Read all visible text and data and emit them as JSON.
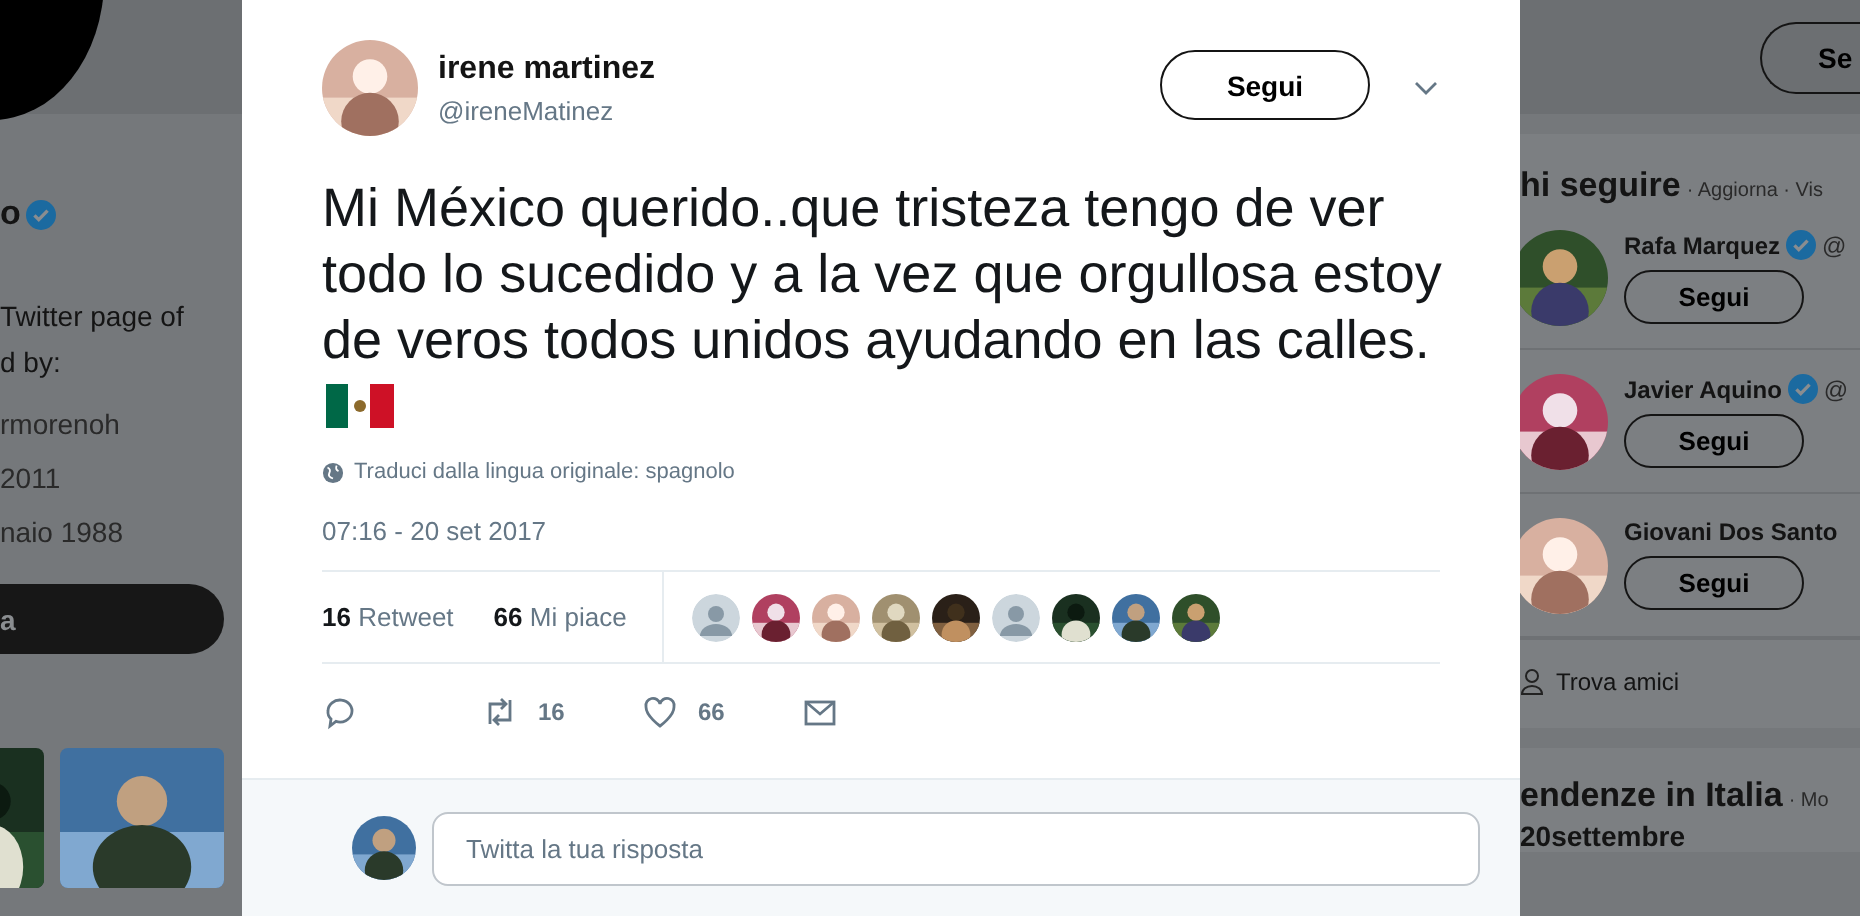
{
  "background_left": {
    "name_fragment": "o",
    "verified": true,
    "bio_lines": [
      "Twitter page of",
      "d by:"
    ],
    "details": [
      "rmorenoh",
      "2011",
      "naio 1988"
    ],
    "button": "a",
    "media": [
      {
        "kind": "picture"
      },
      {
        "kind": "picture"
      }
    ]
  },
  "tweet": {
    "author": {
      "name": "irene martinez",
      "handle": "@ireneMatinez"
    },
    "follow_button": "Segui",
    "text": "Mi México querido..que tristeza tengo de ver todo lo sucedido y a la vez que orgullosa estoy de veros todos unidos ayudando en las calles.",
    "translate": "Traduci dalla lingua originale: spagnolo",
    "timestamp": "07:16 - 20 set 2017",
    "stats": [
      {
        "count": "16",
        "label": "Retweet"
      },
      {
        "count": "66",
        "label": "Mi piace"
      }
    ],
    "likers": [
      {
        "kind": "default"
      },
      {
        "kind": "picture"
      },
      {
        "kind": "picture"
      },
      {
        "kind": "picture"
      },
      {
        "kind": "picture"
      },
      {
        "kind": "default"
      },
      {
        "kind": "picture"
      },
      {
        "kind": "picture"
      },
      {
        "kind": "picture"
      }
    ],
    "actions": [
      {
        "kind": "reply"
      },
      {
        "kind": "retweet",
        "count": "16"
      },
      {
        "kind": "like",
        "count": "66"
      },
      {
        "kind": "message"
      }
    ],
    "reply": {
      "placeholder": "Twitta la tua risposta"
    }
  },
  "background_right": {
    "top_button": "Se",
    "who_to_follow": {
      "title": "hi seguire",
      "links": "· Aggiorna · Vis",
      "people": [
        {
          "name": "Rafa Marquez",
          "verified": true,
          "handle": "@",
          "button": "Segui"
        },
        {
          "name": "Javier Aquino",
          "verified": true,
          "handle": "@",
          "button": "Segui"
        },
        {
          "name": "Giovani Dos Santo",
          "button": "Segui"
        }
      ],
      "find_friends": "Trova amici"
    },
    "trends": {
      "title": "endenze in Italia",
      "links": "· Mo",
      "items": [
        "20settembre"
      ]
    }
  }
}
